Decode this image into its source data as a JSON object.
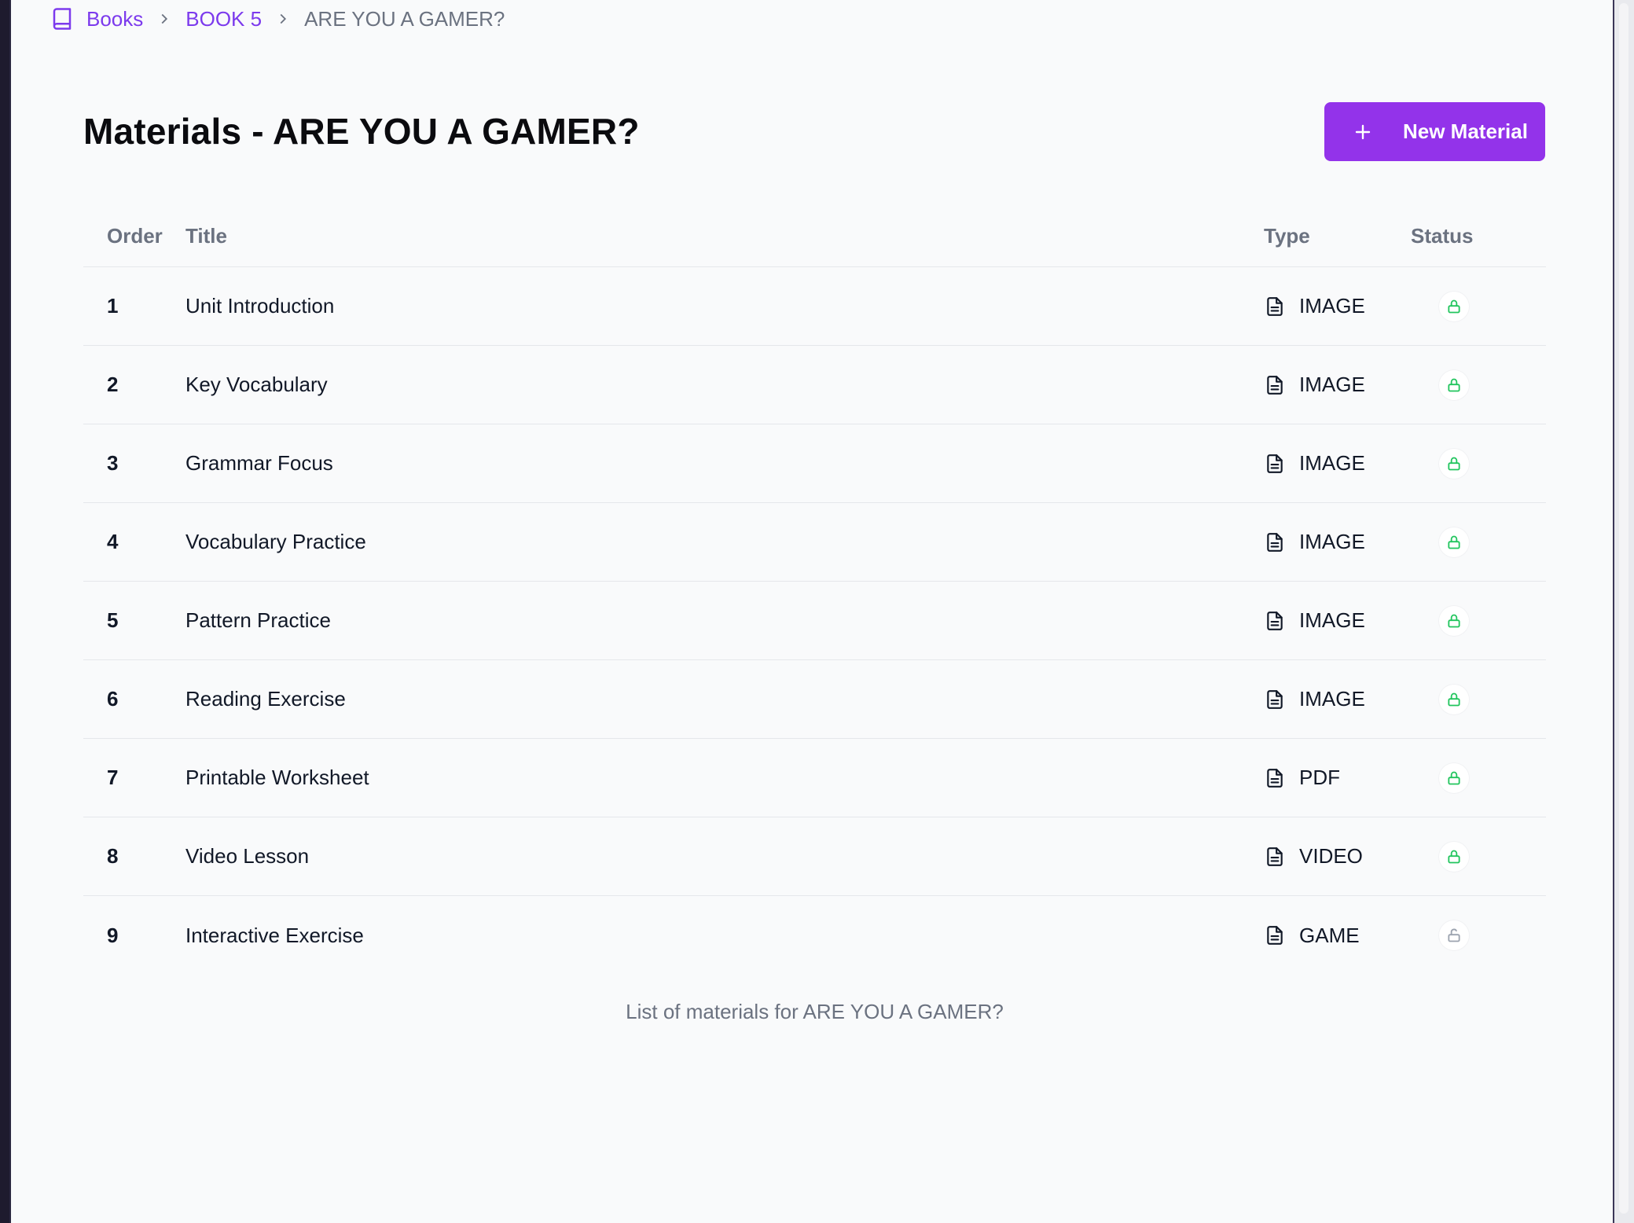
{
  "breadcrumb": {
    "icon": "book-icon",
    "items": [
      "Books",
      "BOOK 5"
    ],
    "current": "ARE YOU A GAMER?"
  },
  "header": {
    "title": "Materials - ARE YOU A GAMER?",
    "new_button_label": "New Material"
  },
  "table": {
    "columns": [
      "Order",
      "Title",
      "Type",
      "Status"
    ],
    "rows": [
      {
        "order": "1",
        "title": "Unit Introduction",
        "type": "IMAGE",
        "status": "locked"
      },
      {
        "order": "2",
        "title": "Key Vocabulary",
        "type": "IMAGE",
        "status": "locked"
      },
      {
        "order": "3",
        "title": "Grammar Focus",
        "type": "IMAGE",
        "status": "locked"
      },
      {
        "order": "4",
        "title": "Vocabulary Practice",
        "type": "IMAGE",
        "status": "locked"
      },
      {
        "order": "5",
        "title": "Pattern Practice",
        "type": "IMAGE",
        "status": "locked"
      },
      {
        "order": "6",
        "title": "Reading Exercise",
        "type": "IMAGE",
        "status": "locked"
      },
      {
        "order": "7",
        "title": "Printable Worksheet",
        "type": "PDF",
        "status": "locked"
      },
      {
        "order": "8",
        "title": "Video Lesson",
        "type": "VIDEO",
        "status": "locked"
      },
      {
        "order": "9",
        "title": "Interactive Exercise",
        "type": "GAME",
        "status": "unlocked"
      }
    ],
    "caption": "List of materials for ARE YOU A GAMER?"
  },
  "colors": {
    "accent": "#9333ea",
    "link": "#7c3aed",
    "status_locked": "#22c55e",
    "status_unlocked": "#9ca3af"
  }
}
